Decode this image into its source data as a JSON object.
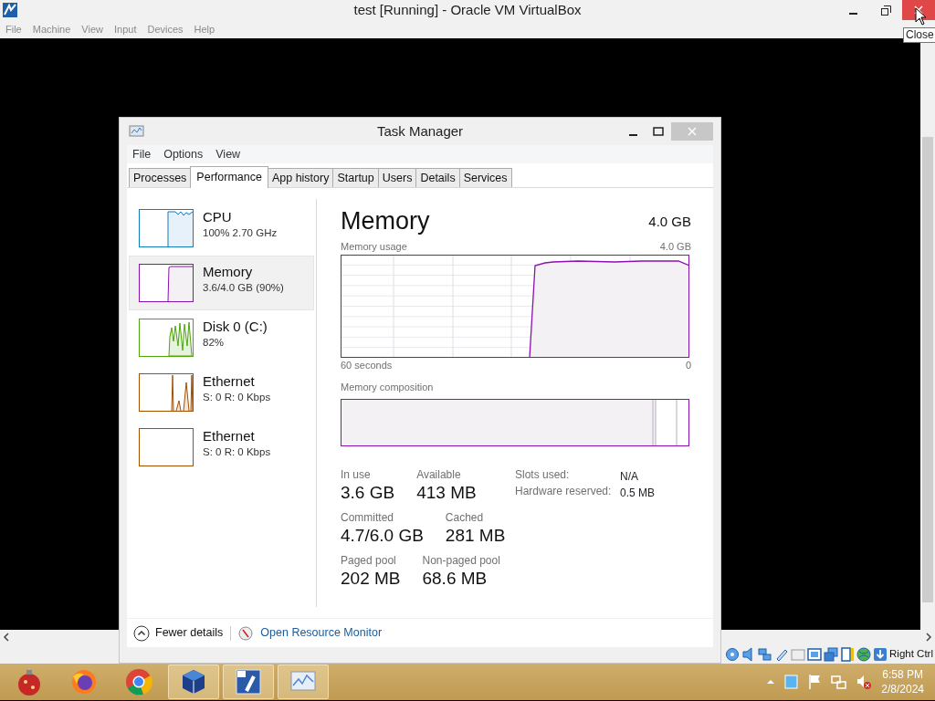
{
  "window": {
    "title": "test [Running] - Oracle VM VirtualBox",
    "menu": [
      "File",
      "Machine",
      "View",
      "Input",
      "Devices",
      "Help"
    ],
    "tooltip": "Close"
  },
  "task_manager": {
    "title": "Task Manager",
    "menu": [
      "File",
      "Options",
      "View"
    ],
    "tabs": [
      {
        "label": "Processes",
        "selected": false
      },
      {
        "label": "Performance",
        "selected": true
      },
      {
        "label": "App history",
        "selected": false
      },
      {
        "label": "Startup",
        "selected": false
      },
      {
        "label": "Users",
        "selected": false
      },
      {
        "label": "Details",
        "selected": false
      },
      {
        "label": "Services",
        "selected": false
      }
    ],
    "sidebar": [
      {
        "kind": "cpu",
        "name": "CPU",
        "detail": "100%  2.70 GHz",
        "color": "#117dbb",
        "selected": false
      },
      {
        "kind": "memory",
        "name": "Memory",
        "detail": "3.6/4.0 GB (90%)",
        "color": "#8b12ae",
        "selected": true
      },
      {
        "kind": "disk",
        "name": "Disk 0 (C:)",
        "detail": "82%",
        "color": "#4da60c",
        "selected": false
      },
      {
        "kind": "network",
        "name": "Ethernet",
        "detail": "S: 0 R: 0 Kbps",
        "color": "#a74f01",
        "selected": false
      },
      {
        "kind": "empty",
        "name": "Ethernet",
        "detail": "S: 0 R: 0 Kbps",
        "color": "#a74f01",
        "selected": false
      }
    ],
    "panel": {
      "title": "Memory",
      "total": "4.0 GB",
      "usage_label": "Memory usage",
      "usage_max": "4.0 GB",
      "x_start": "60 seconds",
      "x_end": "0",
      "composition_label": "Memory composition",
      "stats": [
        {
          "label": "In use",
          "value": "3.6 GB"
        },
        {
          "label": "Available",
          "value": "413 MB"
        },
        {
          "label": "Committed",
          "value": "4.7/6.0 GB"
        },
        {
          "label": "Cached",
          "value": "281 MB"
        },
        {
          "label": "Paged pool",
          "value": "202 MB"
        },
        {
          "label": "Non-paged pool",
          "value": "68.6 MB"
        }
      ],
      "info": [
        {
          "label": "Slots used:",
          "value": "N/A"
        },
        {
          "label": "Hardware reserved:",
          "value": "0.5 MB"
        }
      ]
    },
    "footer": {
      "fewer": "Fewer details",
      "monitor": "Open Resource Monitor"
    }
  },
  "status_bar": {
    "key": "Right Ctrl"
  },
  "taskbar": {
    "apps": [
      {
        "kind": "ornament",
        "active": false
      },
      {
        "kind": "fox",
        "active": false
      },
      {
        "kind": "chrome",
        "active": false
      },
      {
        "kind": "cube",
        "active": true
      },
      {
        "kind": "seven",
        "active": true
      },
      {
        "kind": "monitor",
        "active": true
      }
    ],
    "time": "6:58 PM",
    "date": "2/8/2024"
  }
}
